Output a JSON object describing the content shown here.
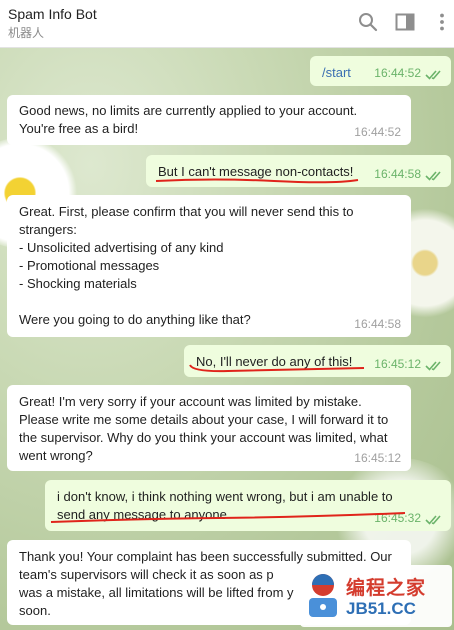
{
  "header": {
    "title": "Spam Info Bot",
    "subtitle": "机器人",
    "icons": [
      "search-icon",
      "sidebar-toggle-icon",
      "more-vertical-icon"
    ]
  },
  "messages": [
    {
      "dir": "out",
      "text": "/start",
      "time": "16:44:52"
    },
    {
      "dir": "in",
      "text": "Good news, no limits are currently applied to your account. You're free as a bird!",
      "time": "16:44:52"
    },
    {
      "dir": "out",
      "text": "But I can't message non-contacts!",
      "time": "16:44:58"
    },
    {
      "dir": "in",
      "text": "Great. First, please confirm that you will never send this to strangers:\n- Unsolicited advertising of any kind\n- Promotional messages\n- Shocking materials\n\nWere you going to do anything like that?",
      "time": "16:44:58"
    },
    {
      "dir": "out",
      "text": "No, I'll never do any of this!",
      "time": "16:45:12"
    },
    {
      "dir": "in",
      "text": "Great! I'm very sorry if your account was limited by mistake. Please write me some details about your case, I will forward it to the supervisor. Why do you think your account was limited, what went wrong?",
      "time": "16:45:12"
    },
    {
      "dir": "out",
      "text": "i don't know, i think nothing went wrong, but i am unable to send any message to anyone",
      "time": "16:45:32"
    },
    {
      "dir": "in",
      "text": "Thank you! Your complaint has been successfully submitted. Our team's supervisors will check it as soon as p\nwas a mistake, all limitations will be lifted from y\nsoon.",
      "time": ""
    }
  ],
  "watermark": {
    "cn": "编程之家",
    "en": "JB51.CC"
  },
  "colors": {
    "accent": "#6bb36a",
    "annotation": "#e0241b",
    "outgoing_bg": "#effdde"
  }
}
